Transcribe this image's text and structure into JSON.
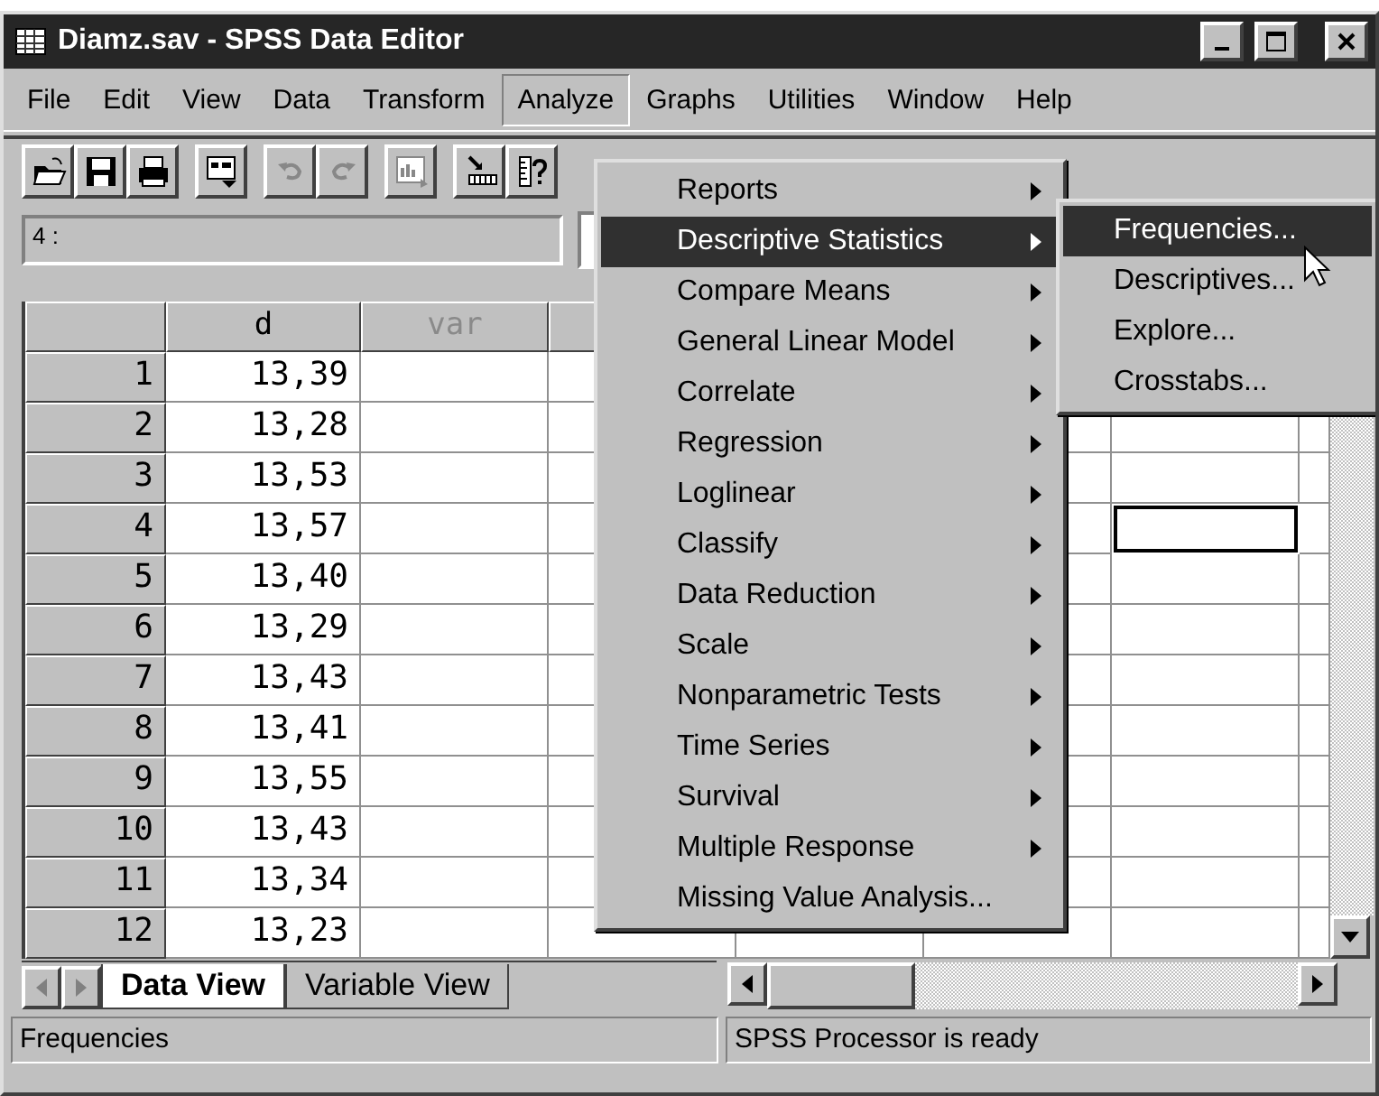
{
  "window": {
    "title": "Diamz.sav - SPSS Data Editor"
  },
  "menubar": [
    {
      "label": "File",
      "selected": false
    },
    {
      "label": "Edit",
      "selected": false
    },
    {
      "label": "View",
      "selected": false
    },
    {
      "label": "Data",
      "selected": false
    },
    {
      "label": "Transform",
      "selected": false
    },
    {
      "label": "Analyze",
      "selected": true
    },
    {
      "label": "Graphs",
      "selected": false
    },
    {
      "label": "Utilities",
      "selected": false
    },
    {
      "label": "Window",
      "selected": false
    },
    {
      "label": "Help",
      "selected": false
    }
  ],
  "toolbar": [
    {
      "kind": "open",
      "disabled": false
    },
    {
      "kind": "save",
      "disabled": false
    },
    {
      "kind": "print",
      "disabled": false
    },
    {
      "kind": "dialog",
      "disabled": false
    },
    {
      "kind": "undo",
      "disabled": true
    },
    {
      "kind": "redo",
      "disabled": true
    },
    {
      "kind": "chart",
      "disabled": true
    },
    {
      "kind": "goto",
      "disabled": false
    },
    {
      "kind": "variables",
      "disabled": false
    }
  ],
  "cell_editor": {
    "cell": "4 :"
  },
  "grid": {
    "columns": [
      {
        "label": "d",
        "kind": "variable"
      },
      {
        "label": "var",
        "kind": "empty"
      },
      {
        "kind": "empty"
      },
      {
        "kind": "empty"
      },
      {
        "kind": "empty"
      },
      {
        "kind": "empty"
      }
    ],
    "rows": [
      {
        "number": "1",
        "values": [
          "13,39"
        ],
        "active": false
      },
      {
        "number": "2",
        "values": [
          "13,28"
        ],
        "active": false
      },
      {
        "number": "3",
        "values": [
          "13,53"
        ],
        "active": false
      },
      {
        "number": "4",
        "values": [
          "13,57"
        ],
        "active": true
      },
      {
        "number": "5",
        "values": [
          "13,40"
        ],
        "active": false
      },
      {
        "number": "6",
        "values": [
          "13,29"
        ],
        "active": false
      },
      {
        "number": "7",
        "values": [
          "13,43"
        ],
        "active": false
      },
      {
        "number": "8",
        "values": [
          "13,41"
        ],
        "active": false
      },
      {
        "number": "9",
        "values": [
          "13,55"
        ],
        "active": false
      },
      {
        "number": "10",
        "values": [
          "13,43"
        ],
        "active": false
      },
      {
        "number": "11",
        "values": [
          "13,34"
        ],
        "active": false
      },
      {
        "number": "12",
        "values": [
          "13,23"
        ],
        "active": false
      }
    ]
  },
  "tabs": [
    {
      "label": "Data View",
      "selected": true
    },
    {
      "label": "Variable View",
      "selected": false
    }
  ],
  "analyze_menu": [
    {
      "label": "Reports",
      "submenu": true,
      "selected": false
    },
    {
      "label": "Descriptive Statistics",
      "submenu": true,
      "selected": true
    },
    {
      "label": "Compare Means",
      "submenu": true,
      "selected": false
    },
    {
      "label": "General Linear Model",
      "submenu": true,
      "selected": false
    },
    {
      "label": "Correlate",
      "submenu": true,
      "selected": false
    },
    {
      "label": "Regression",
      "submenu": true,
      "selected": false
    },
    {
      "label": "Loglinear",
      "submenu": true,
      "selected": false
    },
    {
      "label": "Classify",
      "submenu": true,
      "selected": false
    },
    {
      "label": "Data Reduction",
      "submenu": true,
      "selected": false
    },
    {
      "label": "Scale",
      "submenu": true,
      "selected": false
    },
    {
      "label": "Nonparametric Tests",
      "submenu": true,
      "selected": false
    },
    {
      "label": "Time Series",
      "submenu": true,
      "selected": false
    },
    {
      "label": "Survival",
      "submenu": true,
      "selected": false
    },
    {
      "label": "Multiple Response",
      "submenu": true,
      "selected": false
    },
    {
      "label": "Missing Value Analysis...",
      "submenu": false,
      "selected": false
    }
  ],
  "descriptive_submenu": [
    {
      "label": "Frequencies...",
      "selected": true
    },
    {
      "label": "Descriptives...",
      "selected": false
    },
    {
      "label": "Explore...",
      "selected": false
    },
    {
      "label": "Crosstabs...",
      "selected": false
    }
  ],
  "status_bar": {
    "message": "Frequencies",
    "processor": "SPSS Processor  is ready"
  }
}
